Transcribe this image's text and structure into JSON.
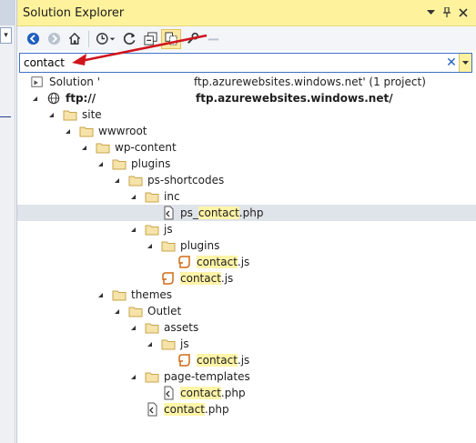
{
  "panel": {
    "title": "Solution Explorer"
  },
  "colors": {
    "title_bg": "#fff29d",
    "highlight": "#fff4a8",
    "selected_row": "#dfe3ea",
    "arrow_annotation": "#d0141c",
    "folder": "#d9b45b"
  },
  "toolbar": {
    "icons": [
      "back-icon",
      "forward-icon",
      "home-icon",
      "history-icon",
      "refresh-icon",
      "collapse-all-icon",
      "show-all-files-icon",
      "properties-icon",
      "preview-icon"
    ]
  },
  "search": {
    "value": "contact",
    "clear_glyph": "✕"
  },
  "solution": {
    "label": "Solution '",
    "site": "ftp.azurewebsites.windows.net",
    "suffix": "' (1 project)"
  },
  "project": {
    "label": "ftp://",
    "site": "ftp.azurewebsites.windows.net/"
  },
  "tree": {
    "site": "site",
    "wwwroot": "wwwroot",
    "wp_content": "wp-content",
    "plugins": "plugins",
    "ps_shortcodes": "ps-shortcodes",
    "inc": "inc",
    "ps_contact_pre": "ps_",
    "ps_contact_hl": "contact",
    "ps_contact_post": ".php",
    "js": "js",
    "plugins2": "plugins",
    "contact_js_1_hl": "contact",
    "contact_js_1_post": ".js",
    "contact_js_2_hl": "contact",
    "contact_js_2_post": ".js",
    "themes": "themes",
    "outlet": "Outlet",
    "assets": "assets",
    "js2": "js",
    "contact_js_3_hl": "contact",
    "contact_js_3_post": ".js",
    "page_templates": "page-templates",
    "contact_php_1_hl": "contact",
    "contact_php_1_post": ".php",
    "contact_php_2_hl": "contact",
    "contact_php_2_post": ".php"
  }
}
